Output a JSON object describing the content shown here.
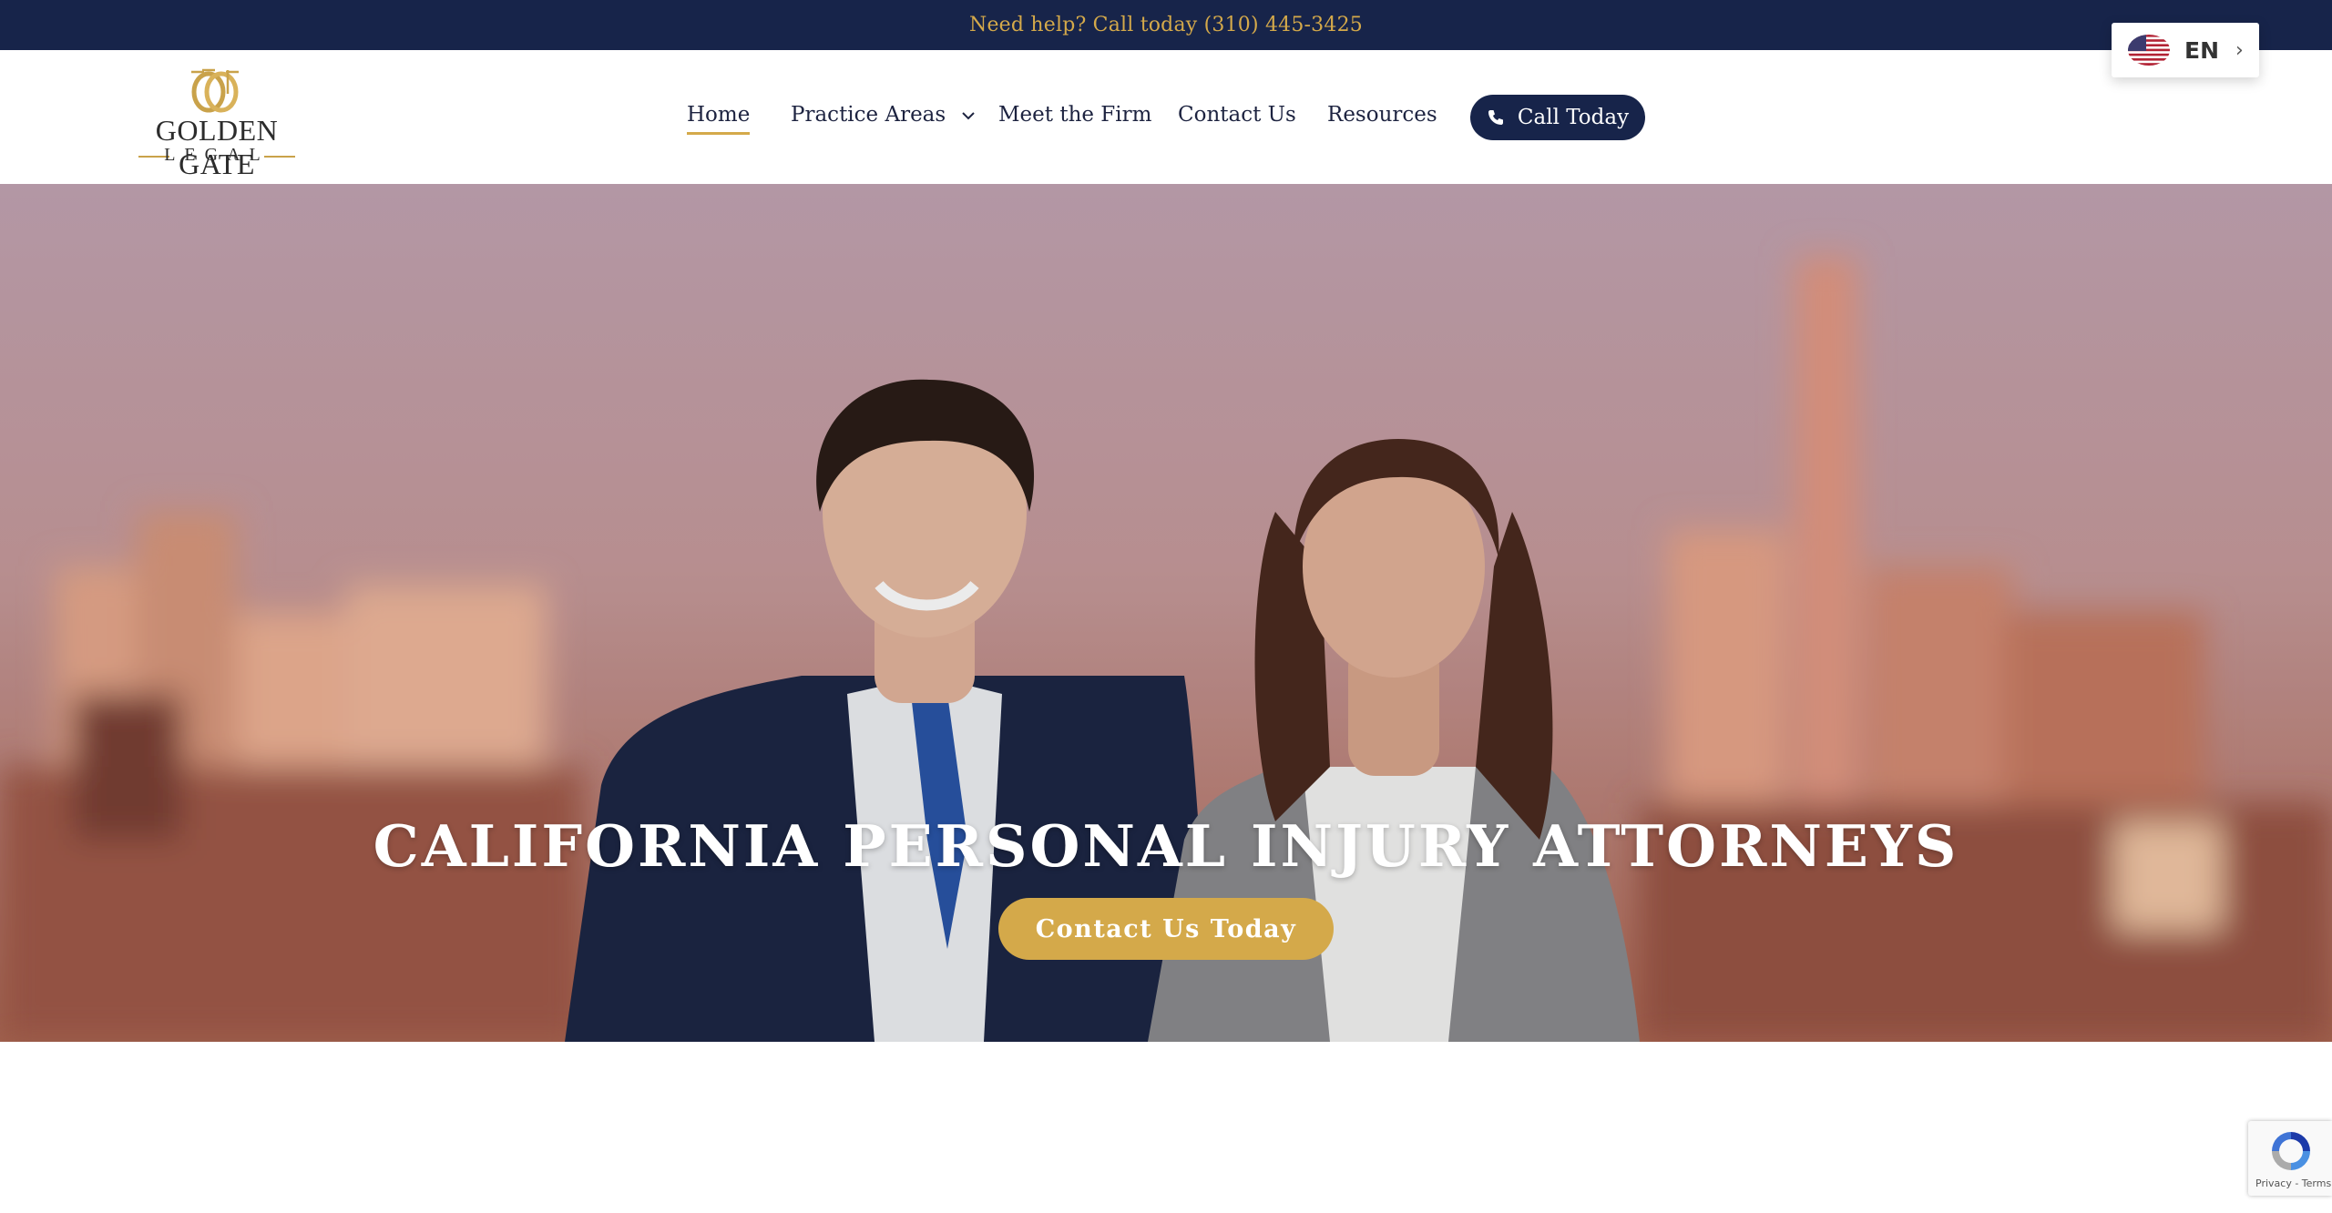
{
  "topbar": {
    "help_text": "Need help? Call today (310) 445-3425"
  },
  "logo": {
    "name": "GOLDEN GATE",
    "subtitle": "LEGAL"
  },
  "nav": {
    "items": [
      {
        "label": "Home",
        "active": true
      },
      {
        "label": "Practice Areas",
        "has_dropdown": true
      },
      {
        "label": "Meet the Firm"
      },
      {
        "label": "Contact Us"
      },
      {
        "label": "Resources"
      }
    ],
    "cta_label": "Call Today"
  },
  "language": {
    "code": "EN",
    "flag_icon": "us-flag-icon"
  },
  "hero": {
    "title": "CALIFORNIA PERSONAL INJURY ATTORNEYS",
    "cta_label": "Contact Us Today"
  },
  "recaptcha": {
    "links": "Privacy - Terms"
  },
  "colors": {
    "navy": "#17244a",
    "gold": "#d4a94a",
    "white": "#ffffff"
  }
}
